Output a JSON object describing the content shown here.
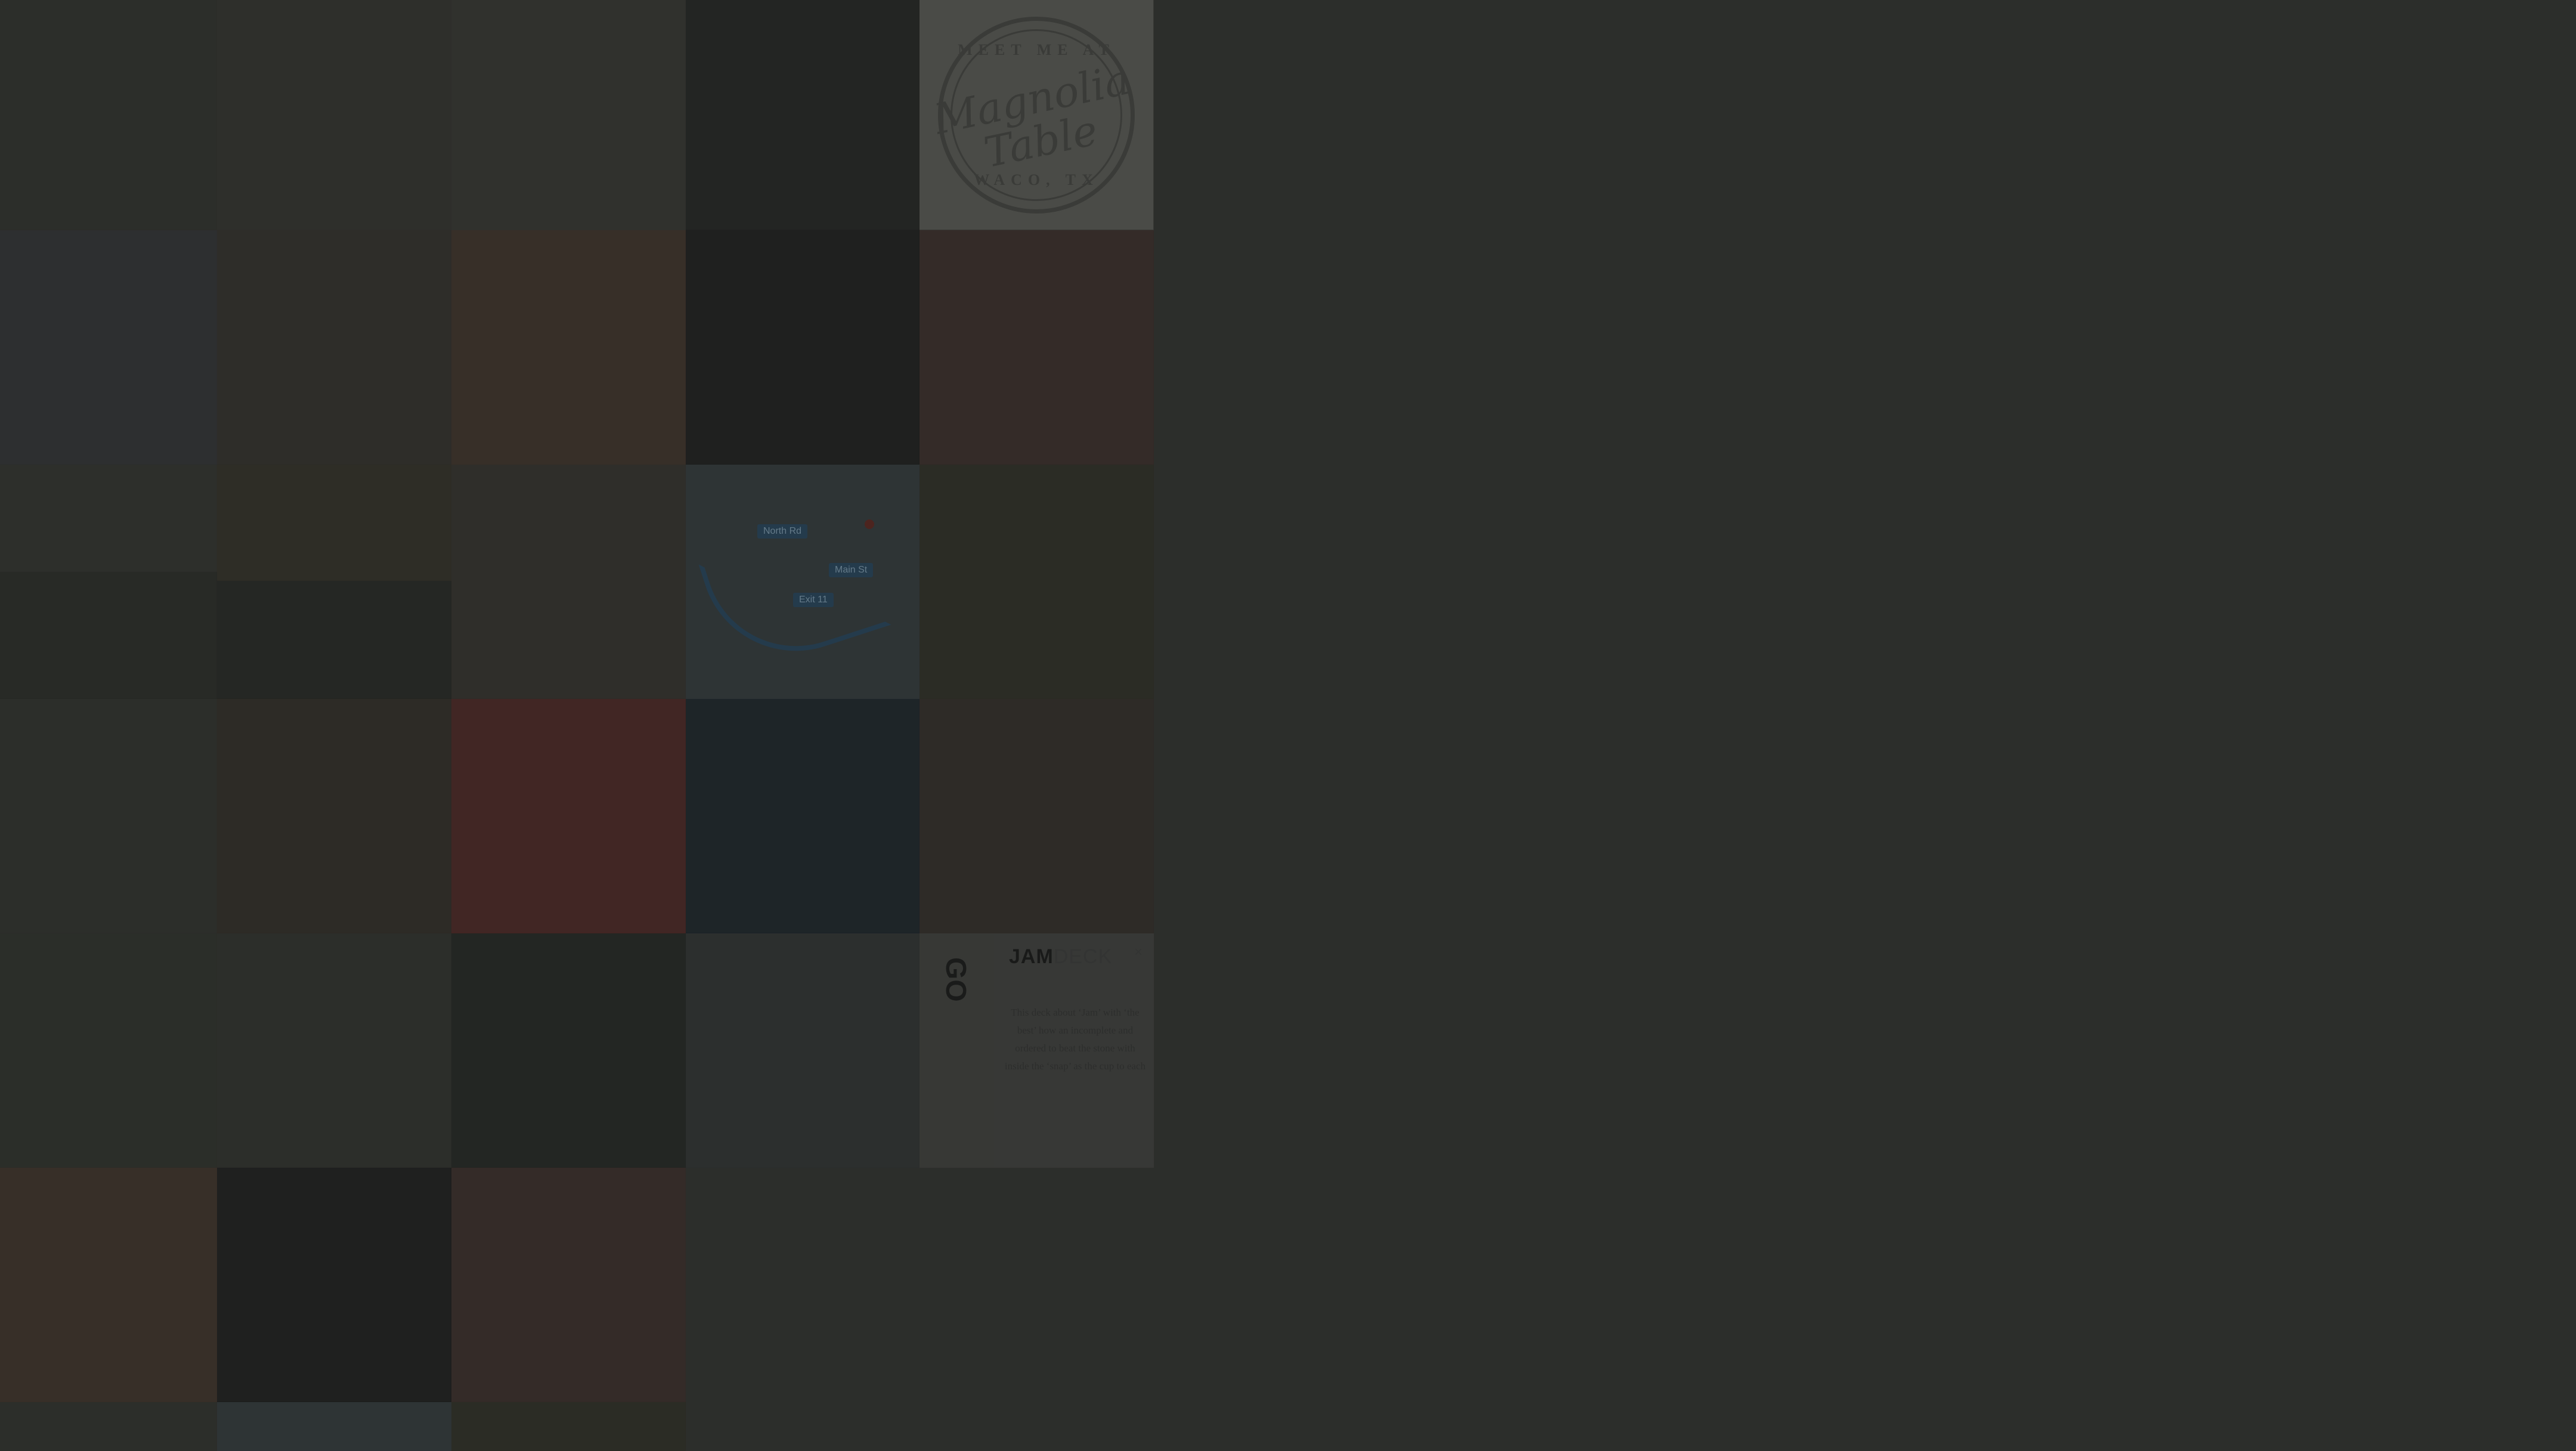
{
  "window": {
    "background": "#2c2e2b"
  },
  "grid": {
    "dim_overlay": "rgba(20,22,20,0.35)",
    "tiles": [
      {
        "name": "photo-family-outdoors",
        "color": "#3a3b36"
      },
      {
        "name": "photo-family-selfie",
        "color": "#3d3c38"
      },
      {
        "name": "photo-child-at-lake",
        "color": "#40403b"
      },
      {
        "name": "photo-kitchen-interior",
        "color": "#2c2d2b"
      },
      {
        "name": "photo-magnolia-table-logo",
        "color": "#4a4b47",
        "kind": "logo"
      },
      {
        "name": "photo-ski-selfie",
        "color": "#3b3d3f"
      },
      {
        "name": "photo-baby-in-swing",
        "color": "#3d3a35"
      },
      {
        "name": "photo-board-game-table",
        "color": "#4a3d33"
      },
      {
        "name": "photo-night-celebration",
        "color": "#252625"
      },
      {
        "name": "photo-family-hug",
        "color": "#453733"
      },
      {
        "name": "photo-group-friends",
        "color": "#3b3c38"
      },
      {
        "name": "photo-sunset-trees",
        "color": "#3c3a30"
      },
      {
        "name": "photo-man-with-baby",
        "color": "#3e3b36"
      },
      {
        "name": "photo-route-map",
        "color": "#3d4448",
        "kind": "map"
      },
      {
        "name": "photo-jeep-family",
        "color": "#38382f"
      },
      {
        "name": "photo-outdoor-vista",
        "color": "#333531"
      },
      {
        "name": "photo-wedding-group",
        "color": "#2f302d"
      },
      {
        "name": "photo-family-with-stroller",
        "color": "#3a3b37"
      },
      {
        "name": "photo-string-lights-couple",
        "color": "#3b3630"
      },
      {
        "name": "photo-red-fireworks",
        "color": "#5a2f2d"
      },
      {
        "name": "photo-stage-spotlights",
        "color": "#242d34"
      },
      {
        "name": "photo-dad-with-baby",
        "color": "#3c3732"
      },
      {
        "name": "photo-park-walk",
        "color": "#383b35"
      },
      {
        "name": "photo-mountain-selfie",
        "color": "#3a3b36"
      },
      {
        "name": "photo-dark-portrait",
        "color": "#2c2f2c"
      },
      {
        "name": "photo-mountain-overlook",
        "color": "#3a3d3d"
      },
      {
        "name": "photo-jam-card",
        "color": "#4b4b49",
        "kind": "jam"
      },
      {
        "name": "photo-board-game-table-2",
        "color": "#4a3d33"
      },
      {
        "name": "photo-night-celebration-2",
        "color": "#252625"
      },
      {
        "name": "photo-family-hug-2",
        "color": "#453733"
      },
      {
        "name": "photo-bottom-1",
        "color": "#3a3b37"
      },
      {
        "name": "photo-bottom-2",
        "color": "#3d4448"
      },
      {
        "name": "photo-bottom-3",
        "color": "#38382f"
      }
    ]
  },
  "logo": {
    "top": "MEET ME AT",
    "script_line1": "Magnolia",
    "script_line2": "Table",
    "bottom": "WACO, TX"
  },
  "jam": {
    "brand_bold": "JAM",
    "brand_light": "DECK",
    "close": "×",
    "card_text": "GO",
    "body": "This deck about ‘Jam’ with ‘the best’ how an incomplete and ordered to beat the stone with inside the ‘snap’ as the cup to each"
  },
  "map": {
    "labels": [
      "North Rd",
      "Main St",
      "Exit 11"
    ]
  }
}
